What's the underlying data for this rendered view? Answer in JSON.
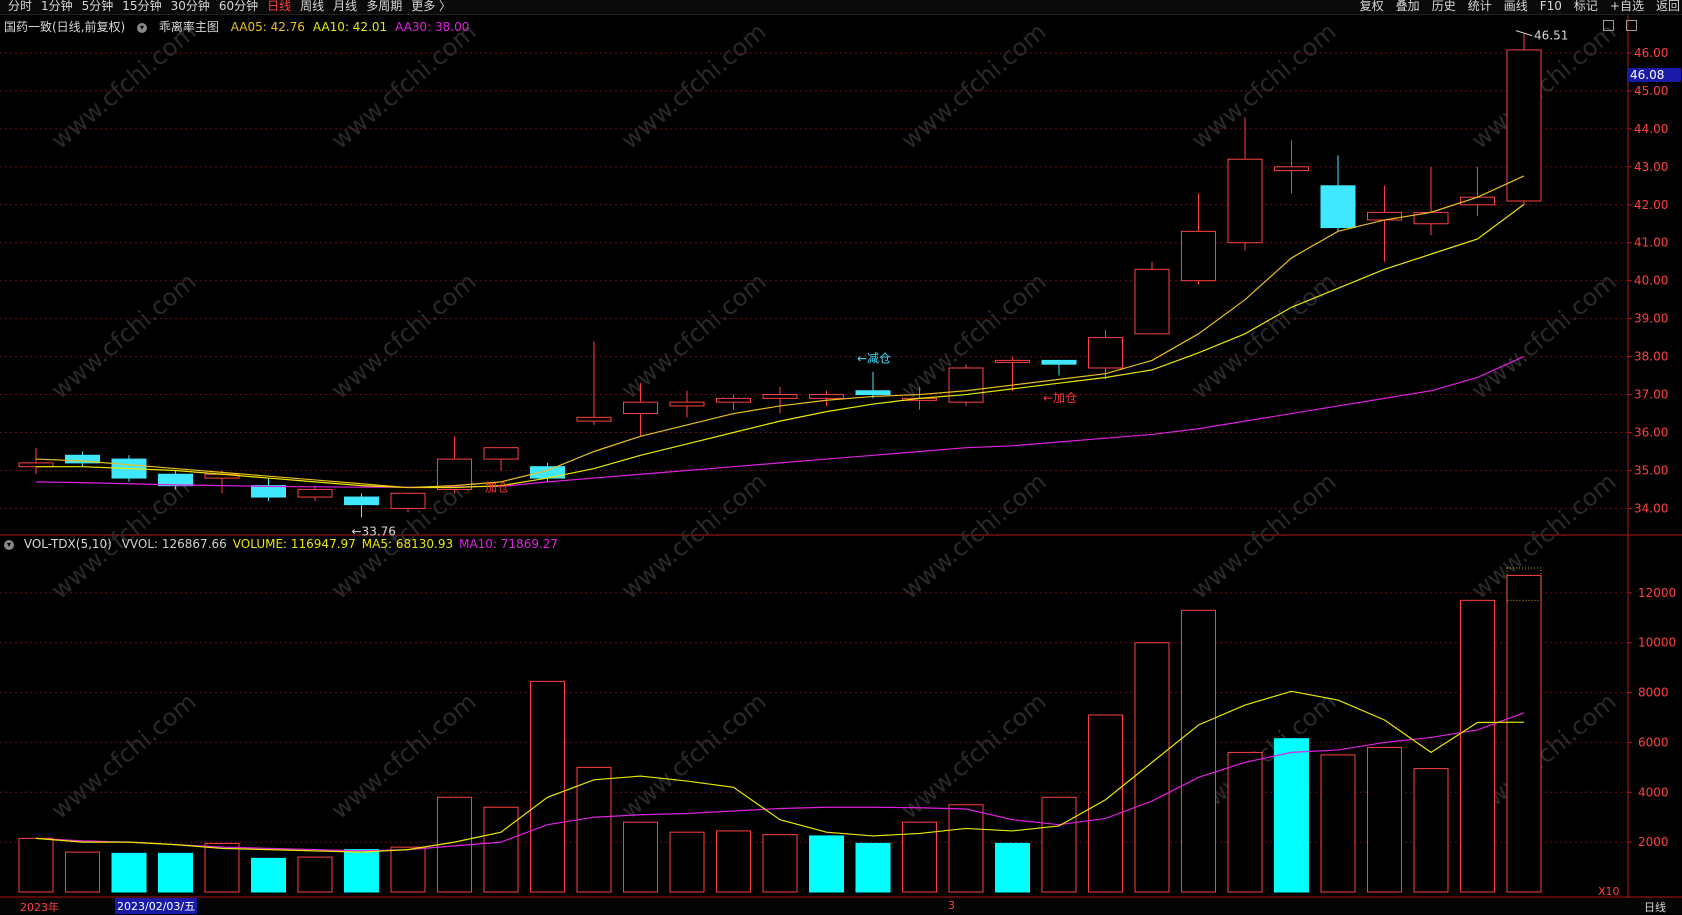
{
  "toolbar": {
    "periods": [
      "分时",
      "1分钟",
      "5分钟",
      "15分钟",
      "30分钟",
      "60分钟",
      "日线",
      "周线",
      "月线",
      "多周期",
      "更多 〉"
    ],
    "active_period": "日线",
    "right_items": [
      "复权",
      "叠加",
      "历史",
      "统计",
      "画线",
      "F10",
      "标记",
      "+自选",
      "返回"
    ]
  },
  "price_panel": {
    "title": "国药一致(日线,前复权)",
    "indicator_name": "乖离率主图",
    "ma_labels": [
      {
        "text": "AA05: 42.76",
        "color": "#e8c020"
      },
      {
        "text": "AA10: 42.01",
        "color": "#e8e800"
      },
      {
        "text": "AA30: 38.00",
        "color": "#e020e0"
      }
    ],
    "y_ticks": [
      "46.00",
      "45.00",
      "44.00",
      "43.00",
      "42.00",
      "41.00",
      "40.00",
      "39.00",
      "38.00",
      "37.00",
      "36.00",
      "35.00",
      "34.00"
    ],
    "y_range": [
      33.3,
      47.0
    ],
    "current_price_badge": "46.08",
    "high_label": "46.51",
    "low_label": "←33.76",
    "annotations": [
      {
        "text": "←减仓",
        "color": "#40e0ff",
        "day": 18,
        "price": 37.85
      },
      {
        "text": "←加仓",
        "color": "#ff3030",
        "day": 22,
        "price": 36.8
      },
      {
        "text": "加仓",
        "color": "#ff3030",
        "day": 10,
        "price": 34.45
      }
    ]
  },
  "volume_panel": {
    "name": "VOL-TDX(5,10)",
    "labels": [
      {
        "text": "VVOL: 126867.66",
        "color": "#d0d0d0"
      },
      {
        "text": "VOLUME: 116947.97",
        "color": "#e8e800"
      },
      {
        "text": "MA5: 68130.93",
        "color": "#e8e800"
      },
      {
        "text": "MA10: 71869.27",
        "color": "#e020e0"
      }
    ],
    "y_ticks": [
      "12000",
      "10000",
      "8000",
      "6000",
      "4000",
      "2000"
    ],
    "y_range": [
      0,
      13800
    ],
    "unit_badge": "X10"
  },
  "bottom_axis": {
    "labels": [
      "2023年",
      "2023/02/03/五",
      "3"
    ],
    "right_label": "日线"
  },
  "chart_data": {
    "type": "candlestick",
    "candles": [
      {
        "o": 35.1,
        "h": 35.6,
        "l": 34.9,
        "c": 35.2,
        "up": true
      },
      {
        "o": 35.4,
        "h": 35.5,
        "l": 35.1,
        "c": 35.2,
        "up": false
      },
      {
        "o": 35.3,
        "h": 35.4,
        "l": 34.7,
        "c": 34.8,
        "up": false
      },
      {
        "o": 34.9,
        "h": 35.0,
        "l": 34.5,
        "c": 34.6,
        "up": false
      },
      {
        "o": 34.9,
        "h": 35.0,
        "l": 34.4,
        "c": 34.8,
        "up": true
      },
      {
        "o": 34.6,
        "h": 34.8,
        "l": 34.2,
        "c": 34.3,
        "up": false
      },
      {
        "o": 34.3,
        "h": 34.6,
        "l": 34.2,
        "c": 34.5,
        "up": true
      },
      {
        "o": 34.3,
        "h": 34.4,
        "l": 33.76,
        "c": 34.1,
        "up": false
      },
      {
        "o": 34.0,
        "h": 34.4,
        "l": 33.9,
        "c": 34.4,
        "up": true
      },
      {
        "o": 34.5,
        "h": 35.9,
        "l": 34.4,
        "c": 35.3,
        "up": true
      },
      {
        "o": 35.3,
        "h": 35.5,
        "l": 35.0,
        "c": 35.6,
        "up": true
      },
      {
        "o": 35.1,
        "h": 35.2,
        "l": 34.7,
        "c": 34.8,
        "up": false
      },
      {
        "o": 36.3,
        "h": 38.4,
        "l": 36.2,
        "c": 36.4,
        "up": true
      },
      {
        "o": 36.5,
        "h": 37.3,
        "l": 35.9,
        "c": 36.8,
        "up": true
      },
      {
        "o": 36.7,
        "h": 37.1,
        "l": 36.4,
        "c": 36.8,
        "up": true
      },
      {
        "o": 36.9,
        "h": 37.0,
        "l": 36.6,
        "c": 36.8,
        "up": true
      },
      {
        "o": 36.9,
        "h": 37.2,
        "l": 36.5,
        "c": 37.0,
        "up": true
      },
      {
        "o": 37.0,
        "h": 37.1,
        "l": 36.7,
        "c": 36.9,
        "up": true
      },
      {
        "o": 37.1,
        "h": 37.6,
        "l": 36.9,
        "c": 37.0,
        "up": false
      },
      {
        "o": 36.9,
        "h": 37.2,
        "l": 36.6,
        "c": 36.9,
        "up": true
      },
      {
        "o": 36.8,
        "h": 37.8,
        "l": 36.7,
        "c": 37.7,
        "up": true
      },
      {
        "o": 37.9,
        "h": 38.0,
        "l": 37.1,
        "c": 37.9,
        "up": true
      },
      {
        "o": 37.9,
        "h": 37.9,
        "l": 37.5,
        "c": 37.8,
        "up": false
      },
      {
        "o": 37.7,
        "h": 38.7,
        "l": 37.4,
        "c": 38.5,
        "up": true
      },
      {
        "o": 38.6,
        "h": 40.5,
        "l": 38.6,
        "c": 40.3,
        "up": true
      },
      {
        "o": 40.0,
        "h": 42.3,
        "l": 39.9,
        "c": 41.3,
        "up": true
      },
      {
        "o": 41.0,
        "h": 44.3,
        "l": 40.8,
        "c": 43.2,
        "up": true
      },
      {
        "o": 43.0,
        "h": 43.7,
        "l": 42.3,
        "c": 42.9,
        "up": true
      },
      {
        "o": 42.5,
        "h": 43.3,
        "l": 41.3,
        "c": 41.4,
        "up": false
      },
      {
        "o": 41.8,
        "h": 42.5,
        "l": 40.5,
        "c": 41.6,
        "up": true
      },
      {
        "o": 41.5,
        "h": 43.0,
        "l": 41.2,
        "c": 41.8,
        "up": true
      },
      {
        "o": 42.0,
        "h": 43.0,
        "l": 41.7,
        "c": 42.2,
        "up": true
      },
      {
        "o": 42.1,
        "h": 46.51,
        "l": 42.0,
        "c": 46.08,
        "up": true
      }
    ],
    "aa05": [
      35.3,
      35.25,
      35.15,
      35.05,
      34.95,
      34.85,
      34.75,
      34.65,
      34.55,
      34.6,
      34.7,
      35.0,
      35.5,
      35.9,
      36.2,
      36.5,
      36.7,
      36.85,
      36.95,
      37.0,
      37.1,
      37.25,
      37.4,
      37.55,
      37.9,
      38.6,
      39.5,
      40.6,
      41.3,
      41.6,
      41.8,
      42.2,
      42.76
    ],
    "aa10": [
      35.1,
      35.1,
      35.05,
      35.0,
      34.9,
      34.8,
      34.7,
      34.6,
      34.55,
      34.55,
      34.6,
      34.8,
      35.05,
      35.4,
      35.7,
      36.0,
      36.3,
      36.55,
      36.75,
      36.9,
      37.0,
      37.15,
      37.3,
      37.45,
      37.65,
      38.1,
      38.6,
      39.3,
      39.8,
      40.3,
      40.7,
      41.1,
      42.01
    ],
    "aa30": [
      34.7,
      34.68,
      34.65,
      34.62,
      34.6,
      34.58,
      34.57,
      34.56,
      34.56,
      34.57,
      34.58,
      34.7,
      34.8,
      34.9,
      35.0,
      35.1,
      35.2,
      35.3,
      35.4,
      35.5,
      35.6,
      35.65,
      35.75,
      35.85,
      35.95,
      36.1,
      36.3,
      36.5,
      36.7,
      36.9,
      37.1,
      37.45,
      38.0
    ],
    "volume": [
      2150,
      1600,
      1550,
      1550,
      1950,
      1350,
      1400,
      1700,
      1800,
      3800,
      3400,
      8450,
      5000,
      2800,
      2400,
      2450,
      2300,
      2250,
      1950,
      2800,
      3500,
      1950,
      3800,
      7100,
      10000,
      11300,
      5600,
      6150,
      5500,
      5800,
      4950,
      11700,
      12700
    ],
    "vol_up": [
      true,
      true,
      false,
      false,
      true,
      false,
      true,
      false,
      true,
      true,
      true,
      true,
      true,
      true,
      true,
      true,
      true,
      false,
      false,
      true,
      true,
      false,
      true,
      true,
      true,
      true,
      true,
      false,
      true,
      true,
      true,
      true,
      true
    ],
    "vol_ma5": [
      2150,
      2000,
      2000,
      1900,
      1750,
      1700,
      1650,
      1600,
      1700,
      2000,
      2400,
      3800,
      4500,
      4650,
      4450,
      4200,
      2900,
      2400,
      2250,
      2350,
      2550,
      2450,
      2650,
      3700,
      5200,
      6700,
      7500,
      8050,
      7700,
      6900,
      5600,
      6800,
      6813
    ],
    "vol_ma10": [
      2150,
      2050,
      2000,
      1900,
      1800,
      1750,
      1700,
      1650,
      1700,
      1850,
      2000,
      2700,
      3000,
      3100,
      3150,
      3250,
      3350,
      3400,
      3400,
      3380,
      3330,
      2900,
      2700,
      2950,
      3650,
      4600,
      5200,
      5600,
      5700,
      6000,
      6200,
      6500,
      7187
    ]
  }
}
